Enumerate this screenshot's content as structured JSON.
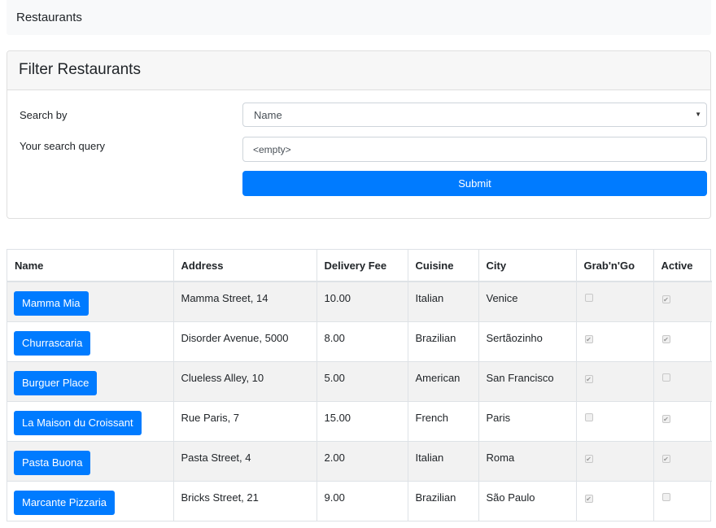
{
  "navbar": {
    "brand": "Restaurants"
  },
  "filter": {
    "title": "Filter Restaurants",
    "search_by_label": "Search by",
    "search_by_value": "Name",
    "query_label": "Your search query",
    "query_placeholder": "<empty>",
    "submit_label": "Submit"
  },
  "table": {
    "headers": [
      "Name",
      "Address",
      "Delivery Fee",
      "Cuisine",
      "City",
      "Grab'n'Go",
      "Active"
    ],
    "rows": [
      {
        "name": "Mamma Mia",
        "address": "Mamma Street, 14",
        "fee": "10.00",
        "cuisine": "Italian",
        "city": "Venice",
        "grab": false,
        "active": true
      },
      {
        "name": "Churrascaria",
        "address": "Disorder Avenue, 5000",
        "fee": "8.00",
        "cuisine": "Brazilian",
        "city": "Sertãozinho",
        "grab": true,
        "active": true
      },
      {
        "name": "Burguer Place",
        "address": "Clueless Alley, 10",
        "fee": "5.00",
        "cuisine": "American",
        "city": "San Francisco",
        "grab": true,
        "active": false
      },
      {
        "name": "La Maison du Croissant",
        "address": "Rue Paris, 7",
        "fee": "15.00",
        "cuisine": "French",
        "city": "Paris",
        "grab": false,
        "active": true
      },
      {
        "name": "Pasta Buona",
        "address": "Pasta Street, 4",
        "fee": "2.00",
        "cuisine": "Italian",
        "city": "Roma",
        "grab": true,
        "active": true
      },
      {
        "name": "Marcante Pizzaria",
        "address": "Bricks Street, 21",
        "fee": "9.00",
        "cuisine": "Brazilian",
        "city": "São Paulo",
        "grab": true,
        "active": false
      }
    ]
  },
  "colors": {
    "primary": "#007bff",
    "stripe": "#f2f2f2",
    "navbar": "#f8f9fa"
  },
  "icons": {
    "select_caret": "caret-down-icon",
    "checkbox_checked": "checkmark-icon"
  }
}
